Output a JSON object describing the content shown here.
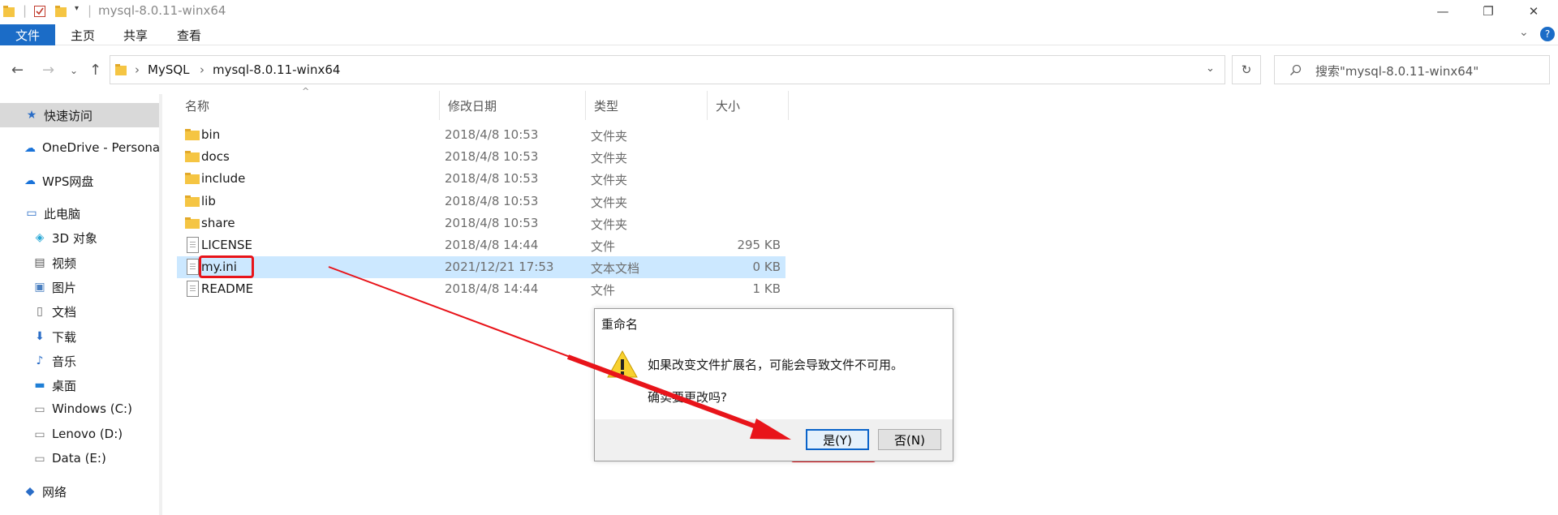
{
  "window": {
    "title": "mysql-8.0.11-winx64",
    "controls": {
      "minimize": "—",
      "maximize": "❐",
      "close": "✕"
    }
  },
  "ribbon": {
    "tabs": [
      {
        "label": "文件"
      },
      {
        "label": "主页"
      },
      {
        "label": "共享"
      },
      {
        "label": "查看"
      }
    ]
  },
  "address": {
    "crumbs": [
      "MySQL",
      "mysql-8.0.11-winx64"
    ],
    "search_placeholder": "搜索\"mysql-8.0.11-winx64\""
  },
  "sidebar": {
    "items": [
      {
        "label": "快速访问",
        "icon": "star-icon"
      },
      {
        "label": "OneDrive - Personal",
        "icon": "cloud-icon"
      },
      {
        "label": "WPS网盘",
        "icon": "cloud-icon"
      },
      {
        "label": "此电脑",
        "icon": "computer-icon"
      },
      {
        "label": "3D 对象",
        "icon": "cube-icon"
      },
      {
        "label": "视频",
        "icon": "video-icon"
      },
      {
        "label": "图片",
        "icon": "picture-icon"
      },
      {
        "label": "文档",
        "icon": "document-icon"
      },
      {
        "label": "下载",
        "icon": "download-icon"
      },
      {
        "label": "音乐",
        "icon": "music-icon"
      },
      {
        "label": "桌面",
        "icon": "desktop-icon"
      },
      {
        "label": "Windows (C:)",
        "icon": "drive-icon"
      },
      {
        "label": "Lenovo (D:)",
        "icon": "drive-icon"
      },
      {
        "label": "Data (E:)",
        "icon": "drive-icon"
      },
      {
        "label": "网络",
        "icon": "network-icon"
      }
    ]
  },
  "columns": {
    "name": "名称",
    "date": "修改日期",
    "type": "类型",
    "size": "大小"
  },
  "files": [
    {
      "name": "bin",
      "date": "2018/4/8 10:53",
      "type": "文件夹",
      "size": "",
      "kind": "folder"
    },
    {
      "name": "docs",
      "date": "2018/4/8 10:53",
      "type": "文件夹",
      "size": "",
      "kind": "folder"
    },
    {
      "name": "include",
      "date": "2018/4/8 10:53",
      "type": "文件夹",
      "size": "",
      "kind": "folder"
    },
    {
      "name": "lib",
      "date": "2018/4/8 10:53",
      "type": "文件夹",
      "size": "",
      "kind": "folder"
    },
    {
      "name": "share",
      "date": "2018/4/8 10:53",
      "type": "文件夹",
      "size": "",
      "kind": "folder"
    },
    {
      "name": "LICENSE",
      "date": "2018/4/8 14:44",
      "type": "文件",
      "size": "295 KB",
      "kind": "file"
    },
    {
      "name": "my.ini",
      "date": "2021/12/21 17:53",
      "type": "文本文档",
      "size": "0 KB",
      "kind": "file"
    },
    {
      "name": "README",
      "date": "2018/4/8 14:44",
      "type": "文件",
      "size": "1 KB",
      "kind": "file"
    }
  ],
  "dialog": {
    "title": "重命名",
    "message": "如果改变文件扩展名，可能会导致文件不可用。",
    "question": "确实要更改吗?",
    "yes_label": "是(Y)",
    "no_label": "否(N)"
  },
  "colors": {
    "accent": "#1b6cc7",
    "selection": "#cce8ff",
    "annotation": "#e8141a"
  }
}
